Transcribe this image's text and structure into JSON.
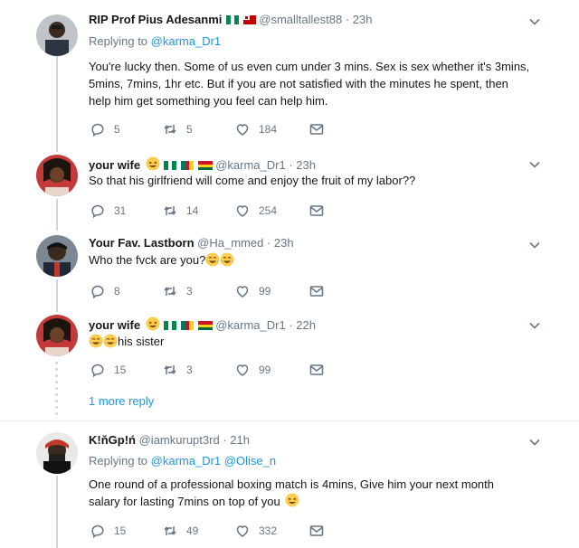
{
  "tweets": [
    {
      "name": "RIP Prof Pius Adesanmi",
      "handle": "@smalltallest88",
      "time": "· 23h",
      "replying_prefix": "Replying to",
      "replying_to": "@karma_Dr1",
      "text": "You're lucky then. Some of us even cum under 3 mins. Sex is sex whether it's 3mins, 5mins, 7mins, 1hr etc. But if you are not satisfied with the minutes he spent, then help him get something you feel can help him.",
      "replies": "5",
      "retweets": "5",
      "likes": "184"
    },
    {
      "name": "your wife",
      "handle": "@karma_Dr1",
      "time": "· 23h",
      "text": "So that his girlfriend will come and enjoy the fruit of my labor??",
      "replies": "31",
      "retweets": "14",
      "likes": "254"
    },
    {
      "name": "Your Fav. Lastborn",
      "handle": "@Ha_mmed",
      "time": "· 23h",
      "text": "Who the fvck are you?",
      "replies": "8",
      "retweets": "3",
      "likes": "99"
    },
    {
      "name": "your wife",
      "handle": "@karma_Dr1",
      "time": "· 22h",
      "text": "his sister",
      "replies": "15",
      "retweets": "3",
      "likes": "99"
    },
    {
      "name": "K!ňGp!ń",
      "handle": "@iamkurupt3rd",
      "time": "· 21h",
      "replying_prefix": "Replying to",
      "replying_to": "@karma_Dr1 @Olise_n",
      "text": "One round of a professional boxing match is 4mins, Give him your next month salary for lasting 7mins on top of you",
      "replies": "15",
      "retweets": "49",
      "likes": "332"
    }
  ],
  "more_replies": "1 more reply",
  "colors": {
    "link": "#1b95e0",
    "muted": "#657786",
    "text": "#14171a",
    "border": "#e6ecf0"
  }
}
